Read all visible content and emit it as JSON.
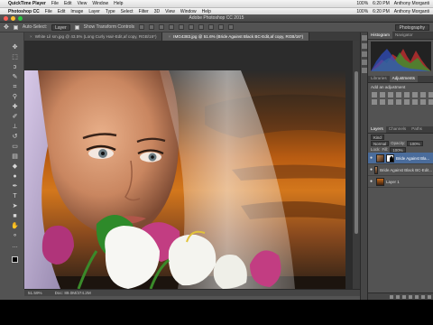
{
  "mac_menubar_1": {
    "apple": "",
    "items": [
      "QuickTime Player",
      "File",
      "Edit",
      "View",
      "Window",
      "Help"
    ],
    "right": {
      "battery": "100%",
      "time": "6:20 PM",
      "user": "Anthony Morganti"
    }
  },
  "mac_menubar_2": {
    "apple": "",
    "items": [
      "Photoshop CC",
      "File",
      "Edit",
      "Image",
      "Layer",
      "Type",
      "Select",
      "Filter",
      "3D",
      "View",
      "Window",
      "Help"
    ],
    "right": {
      "battery": "100%",
      "time": "6:20 PM",
      "user": "Anthony Morganti"
    }
  },
  "app": {
    "title": "Adobe Photoshop CC 2015"
  },
  "options_bar": {
    "auto_select_label": "Auto-Select:",
    "auto_select_value": "Layer",
    "show_transform_label": "Show Transform Controls",
    "workspace": "Photography"
  },
  "doc_tabs": [
    {
      "label": "White Lil sm.jpg @ 43.5% (Long Curly Hair-Edit,af copy, RGB/16*)",
      "active": false
    },
    {
      "label": "IMG4383.jpg @ 51.6% (Bride Against Black BC-Edit,af copy, RGB/16*)",
      "active": true
    }
  ],
  "status_bar": {
    "zoom": "51.59%",
    "doc": "Doc: 89.0M/374.2M"
  },
  "panels": {
    "top_tabs": [
      "Histogram",
      "Navigator"
    ],
    "adjust_tabs": [
      "Libraries",
      "Adjustments"
    ],
    "adjust_title": "Add an adjustment",
    "layers_tabs": [
      "Layers",
      "Channels",
      "Paths"
    ],
    "kind_label": "Kind",
    "blend_mode": "Normal",
    "opacity_label": "Opacity:",
    "opacity_value": "100%",
    "lock_label": "Lock:",
    "fill_label": "Fill:",
    "fill_value": "100%",
    "layers": [
      {
        "name": "Bride Against Bla...",
        "selected": true,
        "mask": true
      },
      {
        "name": "Bride Against Black BC-Edit...",
        "selected": false,
        "mask": false
      },
      {
        "name": "Layer 1",
        "selected": false,
        "mask": false
      }
    ]
  },
  "colors": {
    "ps_bg": "#535353",
    "selected_layer": "#4a6c9b",
    "sky_orange": "#d3771c"
  },
  "tools": [
    "move-icon",
    "marquee-icon",
    "lasso-icon",
    "quick-select-icon",
    "crop-icon",
    "eyedropper-icon",
    "healing-icon",
    "brush-icon",
    "stamp-icon",
    "history-brush-icon",
    "eraser-icon",
    "gradient-icon",
    "blur-icon",
    "dodge-icon",
    "pen-icon",
    "type-icon",
    "path-select-icon",
    "shape-icon",
    "hand-icon",
    "zoom-icon",
    "edit-toolbar-icon"
  ]
}
